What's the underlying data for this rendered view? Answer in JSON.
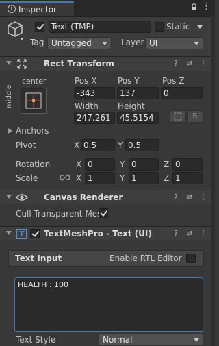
{
  "tab": {
    "title": "Inspector"
  },
  "object": {
    "name": "Text (TMP)",
    "static_label": "Static",
    "tag_label": "Tag",
    "tag_value": "Untagged",
    "layer_label": "Layer",
    "layer_value": "UI"
  },
  "rect_transform": {
    "title": "Rect Transform",
    "anchor_h": "center",
    "anchor_v": "middle",
    "pos_x_label": "Pos X",
    "pos_x": "-343",
    "pos_y_label": "Pos Y",
    "pos_y": "137",
    "pos_z_label": "Pos Z",
    "pos_z": "0",
    "width_label": "Width",
    "width": "247.261",
    "height_label": "Height",
    "height": "45.5154",
    "r_button": "R",
    "anchors_label": "Anchors",
    "pivot_label": "Pivot",
    "pivot_x": "0.5",
    "pivot_y": "0.5",
    "rotation_label": "Rotation",
    "rot_x": "0",
    "rot_y": "0",
    "rot_z": "0",
    "scale_label": "Scale",
    "scale_x": "1",
    "scale_y": "1",
    "scale_z": "1",
    "x": "X",
    "y": "Y",
    "z": "Z"
  },
  "canvas_renderer": {
    "title": "Canvas Renderer",
    "cull_label": "Cull Transparent Mes"
  },
  "tmp": {
    "title": "TextMeshPro - Text (UI)",
    "text_input_label": "Text Input",
    "rtl_label": "Enable RTL Editor",
    "text_value": "HEALTH : 100",
    "text_style_label": "Text Style",
    "text_style_value": "Normal"
  },
  "colors": {
    "background": "#383838",
    "header": "#3e3e3e",
    "field": "#2a2a2a",
    "accent": "#3a79bb"
  }
}
